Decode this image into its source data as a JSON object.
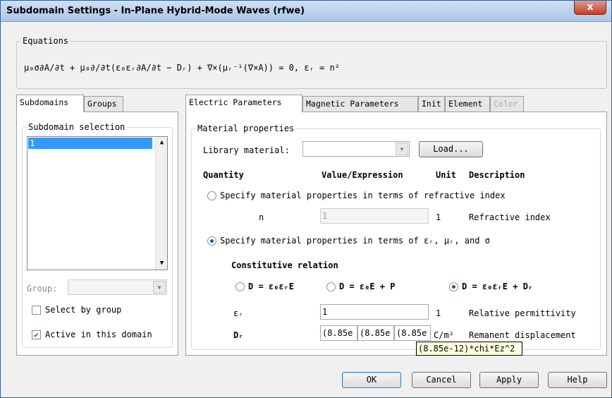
{
  "window": {
    "title": "Subdomain Settings - In-Plane Hybrid-Mode Waves (rfwe)",
    "close_label": "x"
  },
  "equations": {
    "heading": "Equations",
    "text": "μ₀σ∂A/∂t + μ₀∂/∂t(ε₀εᵣ∂A/∂t − Dᵣ) + ∇×(μᵣ⁻¹(∇×A)) = 0,  εᵣ = n²"
  },
  "left_tabs": [
    "Subdomains",
    "Groups"
  ],
  "subdomain_selection": {
    "heading": "Subdomain selection",
    "items": [
      "1"
    ],
    "group_label": "Group:",
    "group_value": "",
    "select_by_group_label": "Select by group",
    "select_by_group_checked": false,
    "active_label": "Active in this domain",
    "active_checked": true
  },
  "right_tabs": [
    "Electric Parameters",
    "Magnetic Parameters",
    "Init",
    "Element",
    "Color"
  ],
  "material": {
    "heading": "Material properties",
    "library_label": "Library material:",
    "library_value": "",
    "load_button": "Load...",
    "col_quantity": "Quantity",
    "col_value": "Value/Expression",
    "col_unit": "Unit",
    "col_description": "Description",
    "option_refractive_label": "Specify material properties in terms of refractive index",
    "option_refractive_checked": false,
    "n_label": "n",
    "n_value": "1",
    "n_unit": "1",
    "n_description": "Refractive index",
    "option_eps_label": "Specify material properties in terms of εᵣ, μᵣ, and σ",
    "option_eps_checked": true,
    "constitutive_heading": "Constitutive relation",
    "relations": [
      {
        "label": "D = ε₀εᵣE",
        "checked": false
      },
      {
        "label": "D = ε₀E + P",
        "checked": false
      },
      {
        "label": "D = ε₀εᵣE + Dᵣ",
        "checked": true
      }
    ],
    "eps_label": "εᵣ",
    "eps_value": "1",
    "eps_unit": "1",
    "eps_description": "Relative permittivity",
    "dr_label": "Dᵣ",
    "dr_values": [
      "(8.85e",
      "(8.85e",
      "(8.85e"
    ],
    "dr_unit": "C/m²",
    "dr_description": "Remanent displacement",
    "tooltip": "(8.85e-12)*chi*Ez^2"
  },
  "buttons": {
    "ok": "OK",
    "cancel": "Cancel",
    "apply": "Apply",
    "help": "Help"
  }
}
